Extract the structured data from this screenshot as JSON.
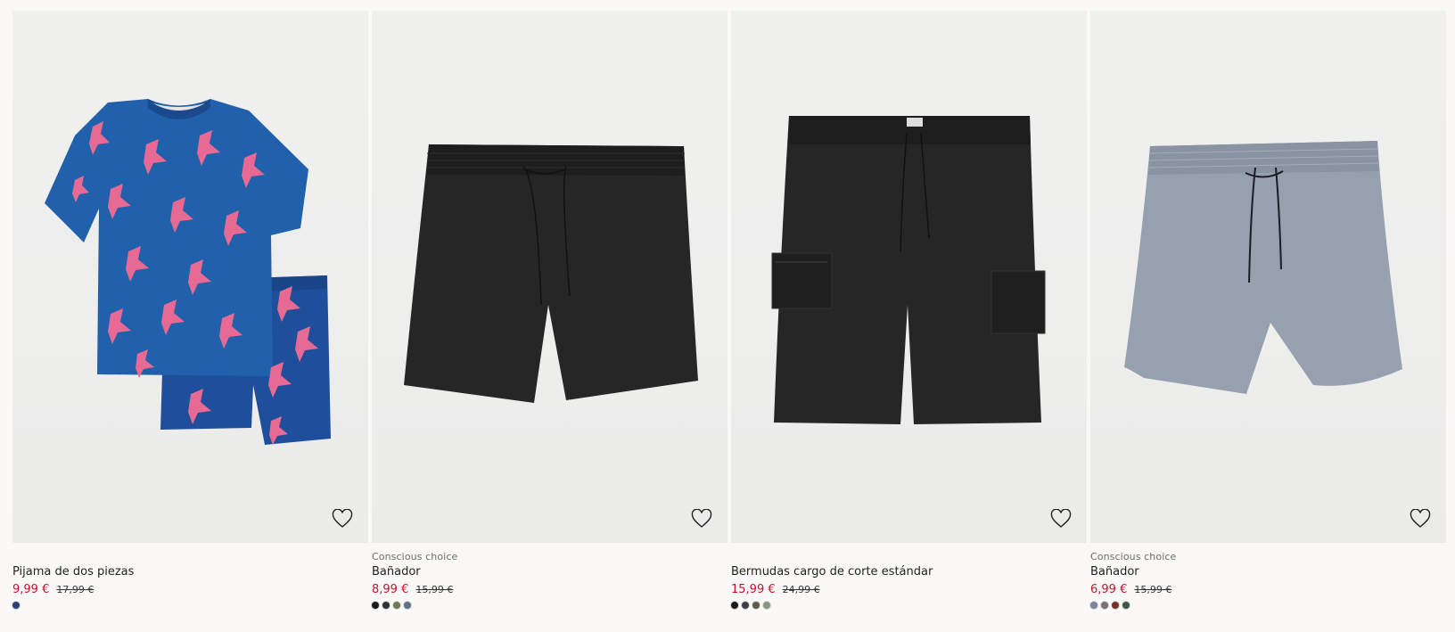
{
  "products": [
    {
      "tag": "",
      "name": "Pijama de dos piezas",
      "price": "9,99 €",
      "old_price": "17,99 €",
      "image": "blue-dinosaur-pajama-set",
      "swatches": [
        "#2b3f74"
      ]
    },
    {
      "tag": "Conscious choice",
      "name": "Bañador",
      "price": "8,99 €",
      "old_price": "15,99 €",
      "image": "black-swim-shorts",
      "swatches": [
        "#1b1b1b",
        "#2f3134",
        "#6f7a56",
        "#5b7288"
      ]
    },
    {
      "tag": "",
      "name": "Bermudas cargo de corte estándar",
      "price": "15,99 €",
      "old_price": "24,99 €",
      "image": "black-cargo-shorts",
      "swatches": [
        "#1b1b1b",
        "#3c3f42",
        "#5c5e4a",
        "#8d9684"
      ]
    },
    {
      "tag": "Conscious choice",
      "name": "Bañador",
      "price": "6,99 €",
      "old_price": "15,99 €",
      "image": "grey-blue-swim-shorts",
      "swatches": [
        "#7a84a0",
        "#7a6f73",
        "#7a2f23",
        "#3f5a47"
      ]
    }
  ],
  "icons": {
    "favorite": "heart-outline-icon"
  },
  "colors": {
    "sale_price": "#c8102e",
    "tag": "#6b6b6b"
  }
}
